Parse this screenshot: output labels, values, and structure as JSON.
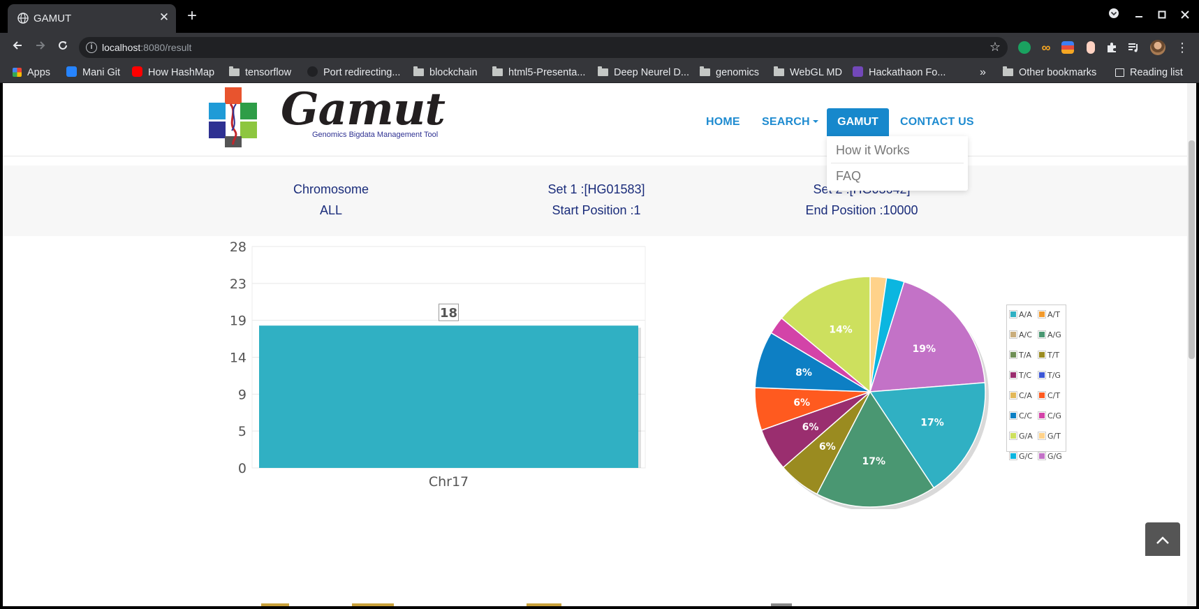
{
  "browser": {
    "tab_title": "GAMUT",
    "tab_close": "✕",
    "new_tab": "+",
    "url_host": "localhost",
    "url_path": ":8080/result",
    "bookmarks": [
      {
        "label": "Apps",
        "icon": "apps-grid-icon"
      },
      {
        "label": "Mani Git",
        "icon": "bitbucket-icon"
      },
      {
        "label": "How HashMap",
        "icon": "youtube-icon"
      },
      {
        "label": "tensorflow",
        "icon": "folder-icon"
      },
      {
        "label": "Port redirecting...",
        "icon": "github-icon"
      },
      {
        "label": "blockchain",
        "icon": "folder-icon"
      },
      {
        "label": "html5-Presenta...",
        "icon": "folder-icon"
      },
      {
        "label": "Deep Neurel D...",
        "icon": "folder-icon"
      },
      {
        "label": "genomics",
        "icon": "folder-icon"
      },
      {
        "label": "WebGL MD",
        "icon": "folder-icon"
      },
      {
        "label": "Hackathaon Fo...",
        "icon": "forms-icon"
      }
    ],
    "more_bookmarks": "»",
    "other_bookmarks": "Other bookmarks",
    "reading_list": "Reading list"
  },
  "header": {
    "logo_title": "Gamut",
    "logo_subtitle": "Genomics Bigdata Management Tool",
    "nav": {
      "home": "HOME",
      "search": "SEARCH",
      "gamut": "GAMUT",
      "contact": "CONTACT US"
    },
    "dropdown": [
      "How it Works",
      "FAQ"
    ]
  },
  "summary": {
    "chromosome_label": "Chromosome",
    "chromosome_value": "ALL",
    "set1": "Set 1 :[HG01583]",
    "start": "Start Position :1",
    "set2": "Set 2 :[HG03642]",
    "end": "End Position :10000"
  },
  "chart_data": [
    {
      "type": "bar",
      "categories": [
        "Chr17"
      ],
      "values": [
        18
      ],
      "ylim": [
        0,
        28
      ],
      "yticks": [
        "28",
        "23",
        "19",
        "14",
        "9",
        "5",
        "0"
      ],
      "data_labels": [
        "18"
      ],
      "grid": true,
      "bar_color": "#30b0c3"
    },
    {
      "type": "pie",
      "slices": [
        {
          "label": "G/T",
          "percent": 2.3,
          "color": "#ffd28a",
          "show": ""
        },
        {
          "label": "G/C",
          "percent": 2.5,
          "color": "#0bb6e0",
          "show": ""
        },
        {
          "label": "G/G",
          "percent": 19,
          "color": "#c372c7",
          "show": "19%"
        },
        {
          "label": "A/A",
          "percent": 17,
          "color": "#30b0c3",
          "show": "17%"
        },
        {
          "label": "A/G",
          "percent": 17,
          "color": "#4a9772",
          "show": "17%"
        },
        {
          "label": "T/T",
          "percent": 6,
          "color": "#9a8b20",
          "show": "6%"
        },
        {
          "label": "T/C",
          "percent": 6,
          "color": "#9a2e6f",
          "show": "6%"
        },
        {
          "label": "C/T",
          "percent": 6,
          "color": "#ff5a1f",
          "show": "6%"
        },
        {
          "label": "C/C",
          "percent": 8,
          "color": "#0d7fc4",
          "show": "8%"
        },
        {
          "label": "C/G",
          "percent": 2.5,
          "color": "#d343a8",
          "show": ""
        },
        {
          "label": "G/A",
          "percent": 14,
          "color": "#cde05e",
          "show": "14%"
        }
      ],
      "legend": [
        {
          "label": "A/A",
          "color": "#30b0c3"
        },
        {
          "label": "A/T",
          "color": "#f29a2c"
        },
        {
          "label": "A/C",
          "color": "#c9ad7c"
        },
        {
          "label": "A/G",
          "color": "#4a9772"
        },
        {
          "label": "T/A",
          "color": "#6f8f56"
        },
        {
          "label": "T/T",
          "color": "#9a8b20"
        },
        {
          "label": "T/C",
          "color": "#9a2e6f"
        },
        {
          "label": "T/G",
          "color": "#3c57d6"
        },
        {
          "label": "C/A",
          "color": "#e2b85a"
        },
        {
          "label": "C/T",
          "color": "#ff5a1f"
        },
        {
          "label": "C/C",
          "color": "#0d7fc4"
        },
        {
          "label": "C/G",
          "color": "#d343a8"
        },
        {
          "label": "G/A",
          "color": "#cde05e"
        },
        {
          "label": "G/T",
          "color": "#ffd28a"
        },
        {
          "label": "G/C",
          "color": "#0bb6e0"
        },
        {
          "label": "G/G",
          "color": "#c372c7"
        }
      ],
      "legend_position": "right"
    }
  ],
  "page": {
    "back_to_top": "︿"
  }
}
